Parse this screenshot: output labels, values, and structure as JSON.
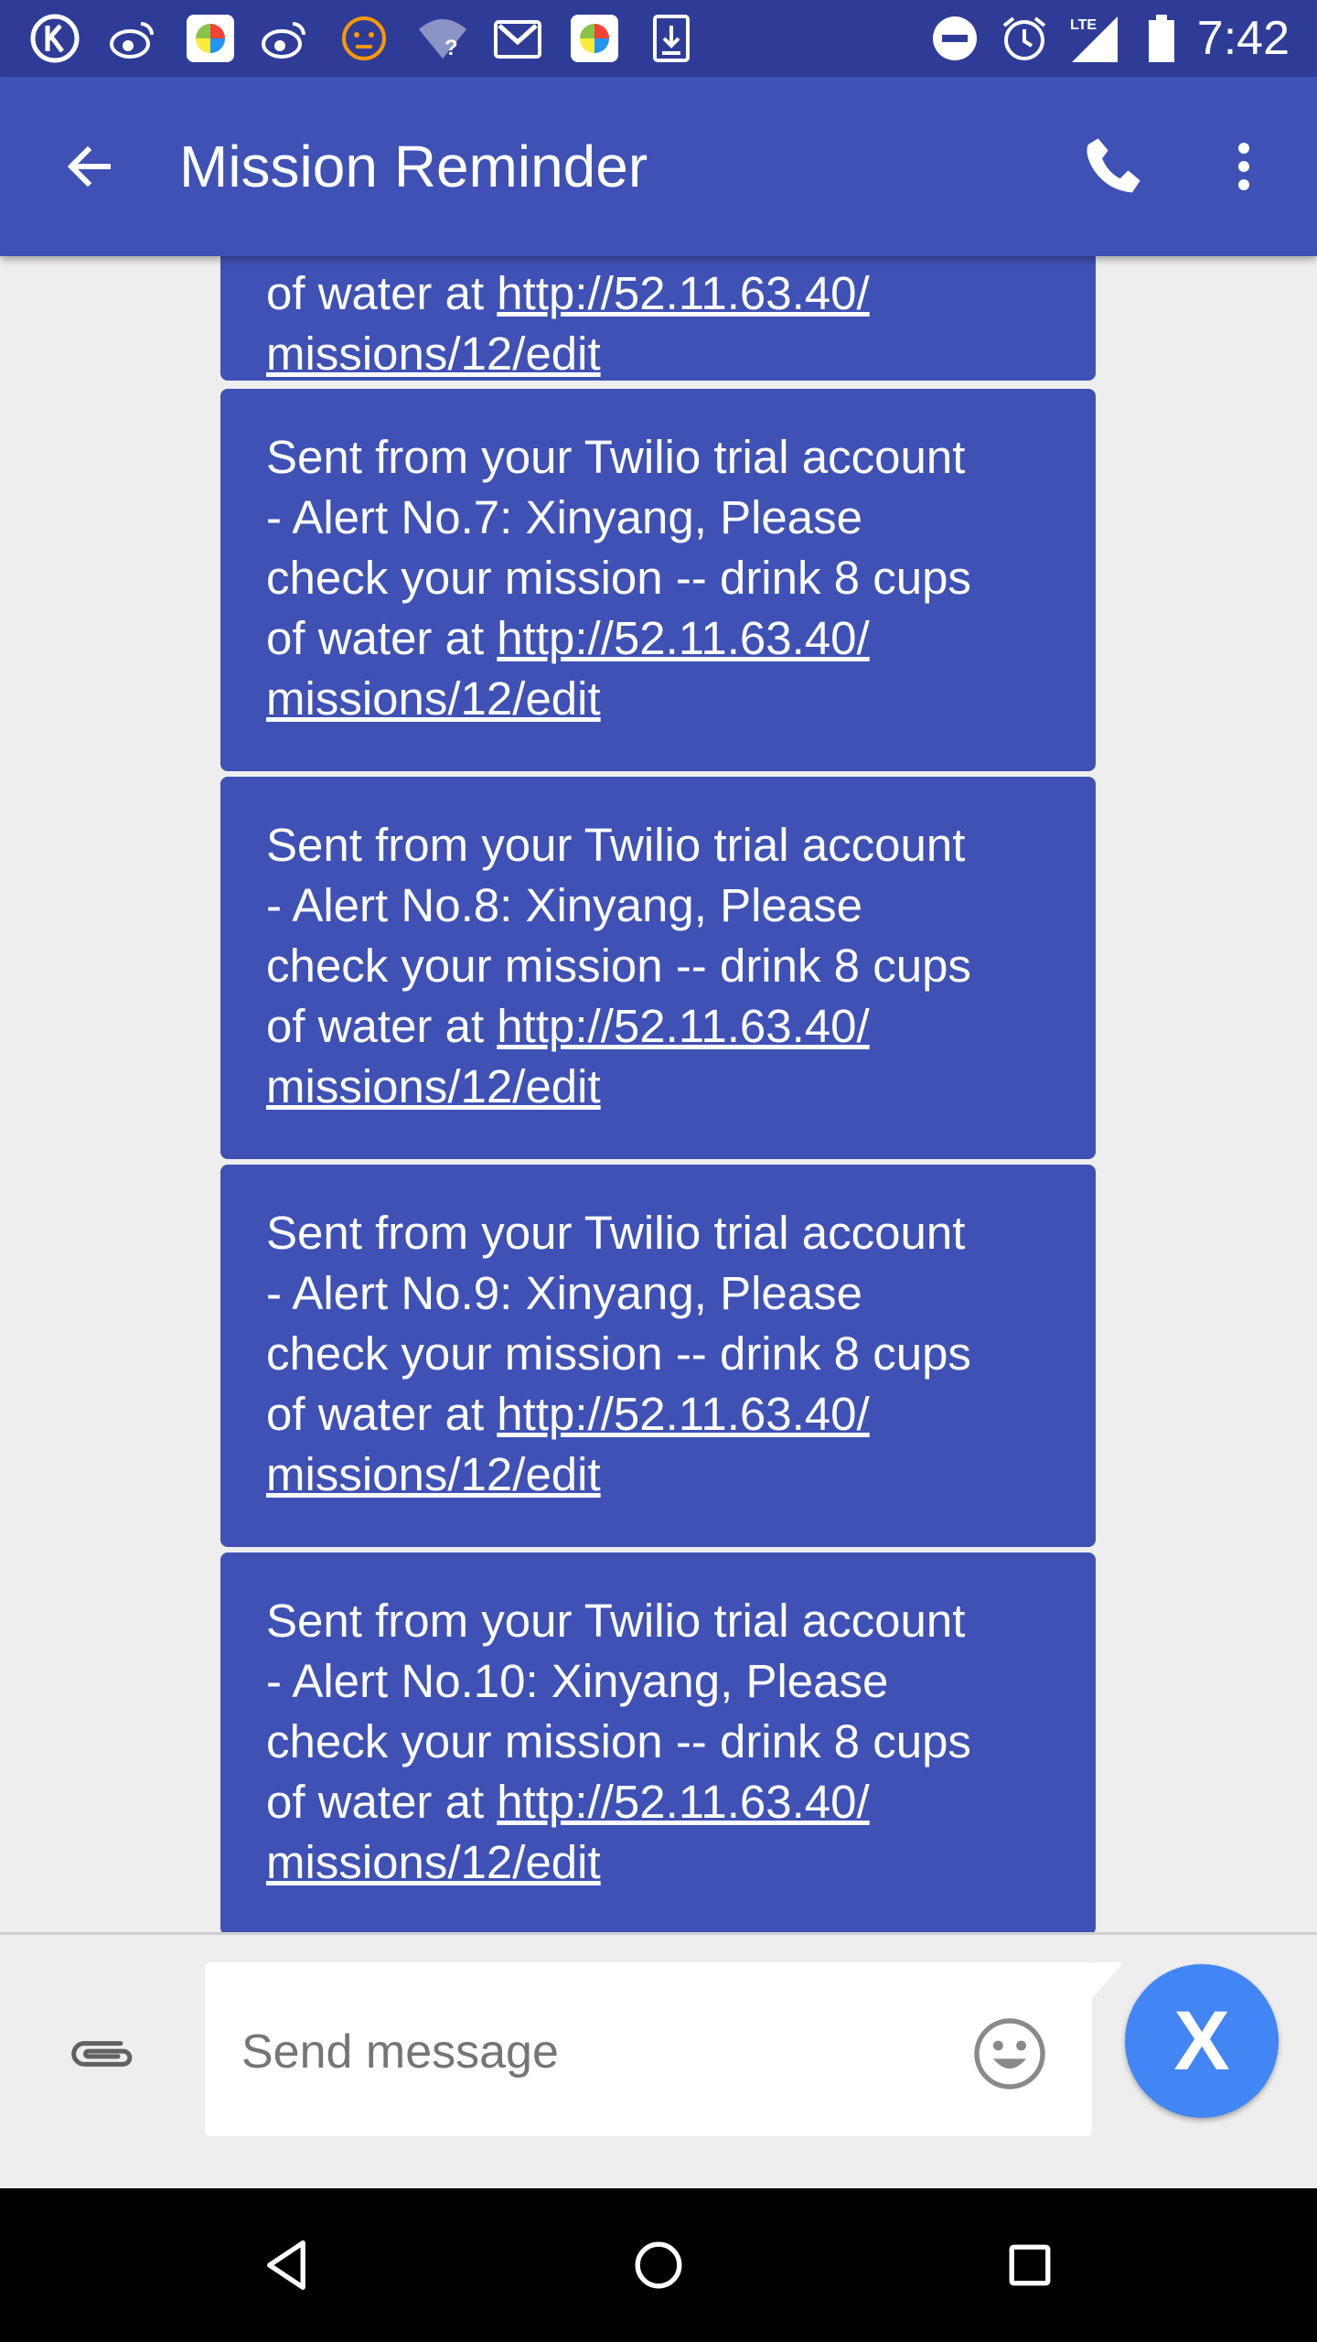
{
  "status_bar": {
    "time": "7:42",
    "left_icons": [
      "k-app-icon",
      "weibo-icon",
      "mi-app-icon",
      "weibo-icon",
      "face-icon",
      "wifi-question-icon",
      "gmail-icon",
      "mi-app-icon",
      "download-icon"
    ],
    "right_icons": [
      "do-not-disturb-icon",
      "alarm-icon",
      "lte-signal-icon",
      "battery-icon"
    ],
    "network_label": "LTE"
  },
  "app_bar": {
    "title": "Mission Reminder",
    "color": "#3f51b5"
  },
  "messages": [
    {
      "partial": true,
      "line4_prefix": "of water at ",
      "link_part1": "http://52.11.63.40/",
      "link_part2": "missions/12/edit"
    },
    {
      "line1": "Sent from your Twilio trial account",
      "line2": "- Alert No.7: Xinyang, Please",
      "line3": "check your mission -- drink 8 cups",
      "line4_prefix": "of water at ",
      "link_part1": "http://52.11.63.40/",
      "link_part2": "missions/12/edit"
    },
    {
      "line1": "Sent from your Twilio trial account",
      "line2": "- Alert No.8: Xinyang, Please",
      "line3": "check your mission -- drink 8 cups",
      "line4_prefix": "of water at ",
      "link_part1": "http://52.11.63.40/",
      "link_part2": "missions/12/edit"
    },
    {
      "line1": "Sent from your Twilio trial account",
      "line2": "- Alert No.9: Xinyang, Please",
      "line3": "check your mission -- drink 8 cups",
      "line4_prefix": "of water at ",
      "link_part1": "http://52.11.63.40/",
      "link_part2": "missions/12/edit"
    },
    {
      "line1": "Sent from your Twilio trial account",
      "line2": "- Alert No.10: Xinyang, Please",
      "line3": "check your mission -- drink 8 cups",
      "line4_prefix": "of water at ",
      "link_part1": "http://52.11.63.40/",
      "link_part2": "missions/12/edit"
    }
  ],
  "compose": {
    "placeholder": "Send message",
    "value": "",
    "send_label": "X",
    "send_color": "#4285f4"
  },
  "nav_bar": {
    "buttons": [
      "back-triangle-icon",
      "home-circle-icon",
      "recents-square-icon"
    ]
  }
}
